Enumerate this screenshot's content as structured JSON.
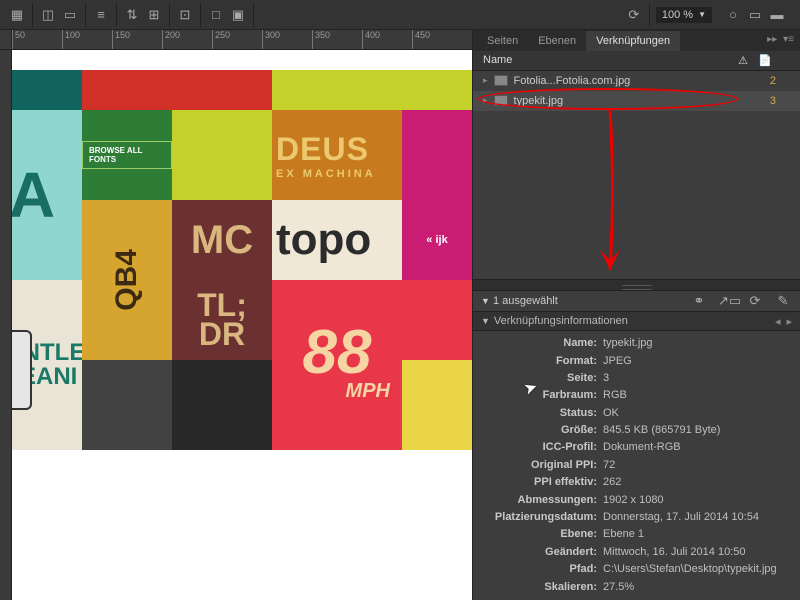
{
  "toolbar": {
    "zoom": "100 %"
  },
  "ruler": [
    "50",
    "100",
    "150",
    "200",
    "250",
    "300",
    "350",
    "400",
    "450"
  ],
  "panel": {
    "tabs": [
      "Seiten",
      "Ebenen",
      "Verknüpfungen"
    ],
    "active_tab": 2,
    "header": {
      "name_col": "Name"
    },
    "rows": [
      {
        "name": "Fotolia...Fotolia.com.jpg",
        "count": "2"
      },
      {
        "name": "typekit.jpg",
        "count": "3"
      }
    ],
    "selected_row": 1,
    "selection_label": "1 ausgewählt",
    "info_title": "Verknüpfungsinformationen",
    "info": [
      {
        "k": "Name:",
        "v": "typekit.jpg"
      },
      {
        "k": "Format:",
        "v": "JPEG"
      },
      {
        "k": "Seite:",
        "v": "3"
      },
      {
        "k": "Farbraum:",
        "v": "RGB"
      },
      {
        "k": "Status:",
        "v": "OK"
      },
      {
        "k": "Größe:",
        "v": "845.5 KB (865791 Byte)"
      },
      {
        "k": "ICC-Profil:",
        "v": "Dokument-RGB"
      },
      {
        "k": "Original PPI:",
        "v": "72"
      },
      {
        "k": "PPI effektiv:",
        "v": "262"
      },
      {
        "k": "Abmessungen:",
        "v": "1902 x 1080"
      },
      {
        "k": "Platzierungsdatum:",
        "v": "Donnerstag, 17. Juli 2014 10:54"
      },
      {
        "k": "Ebene:",
        "v": "Ebene 1"
      },
      {
        "k": "Geändert:",
        "v": "Mittwoch, 16. Juli 2014 10:50"
      },
      {
        "k": "Pfad:",
        "v": "C:\\Users\\Stefan\\Desktop\\typekit.jpg"
      },
      {
        "k": "Skalieren:",
        "v": "27.5%"
      }
    ]
  },
  "art": {
    "browse": "BROWSE ALL FONTS",
    "deus": "DEUS",
    "machina": "EX MACHINA",
    "topo": "topo",
    "eighty": "88",
    "mph": "MPH",
    "gentle": "GENTLE",
    "cleani": "CLEANI",
    "qb4": "QB4",
    "mc": "MC",
    "tl": "TL;",
    "dr": "DR",
    "a": "A",
    "ijk": "« ijk"
  }
}
